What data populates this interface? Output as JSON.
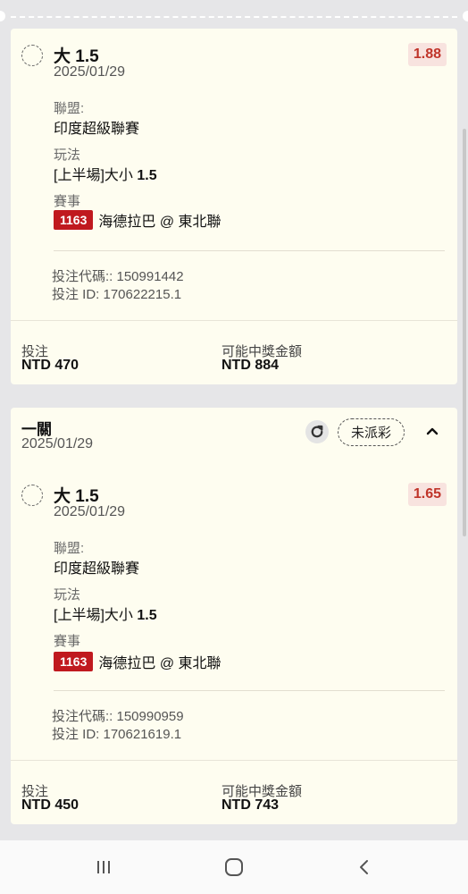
{
  "bets": [
    {
      "selection": "大 1.5",
      "date": "2025/01/29",
      "odds": "1.88",
      "league_label": "聯盟:",
      "league": "印度超級聯賽",
      "market_label": "玩法",
      "market_prefix": "[上半場]大小",
      "market_value": "1.5",
      "event_label": "賽事",
      "event_id": "1163",
      "event_name": "海德拉巴 @ 東北聯",
      "bet_code": "投注代碼:: 150991442",
      "bet_id": "投注 ID: 170622215.1",
      "stake_label": "投注",
      "stake": "NTD 470",
      "payout_label": "可能中獎金額",
      "payout": "NTD 884"
    },
    {
      "header_title": "一關",
      "header_date": "2025/01/29",
      "status": "未派彩",
      "selection": "大 1.5",
      "date": "2025/01/29",
      "odds": "1.65",
      "league_label": "聯盟:",
      "league": "印度超級聯賽",
      "market_label": "玩法",
      "market_prefix": "[上半場]大小",
      "market_value": "1.5",
      "event_label": "賽事",
      "event_id": "1163",
      "event_name": "海德拉巴 @ 東北聯",
      "bet_code": "投注代碼:: 150990959",
      "bet_id": "投注 ID: 170621619.1",
      "stake_label": "投注",
      "stake": "NTD 450",
      "payout_label": "可能中獎金額",
      "payout": "NTD 743"
    }
  ],
  "icons": {
    "refresh": "refresh-icon",
    "expand": "chevron-up-icon",
    "nav_recent": "recent-apps-icon",
    "nav_home": "home-icon",
    "nav_back": "back-icon"
  },
  "colors": {
    "odds_text": "#c0352a",
    "odds_bg": "#f8e3df",
    "event_badge": "#c0191f",
    "card_bg": "#fefdf0"
  }
}
